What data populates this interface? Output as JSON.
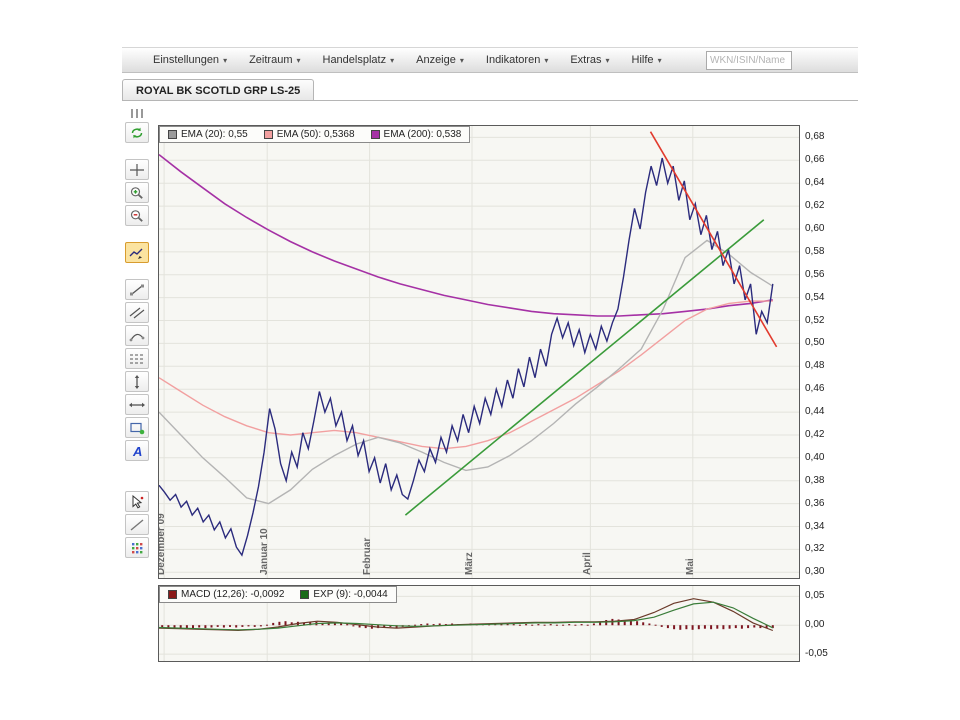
{
  "menubar": {
    "items": [
      {
        "label": "Einstellungen"
      },
      {
        "label": "Zeitraum"
      },
      {
        "label": "Handelsplatz"
      },
      {
        "label": "Anzeige"
      },
      {
        "label": "Indikatoren"
      },
      {
        "label": "Extras"
      },
      {
        "label": "Hilfe"
      }
    ],
    "search_placeholder": "WKN/ISIN/Name"
  },
  "tab": {
    "label": "ROYAL BK SCOTLD GRP LS-25"
  },
  "toolbar": {
    "items": [
      "drag-grip",
      "refresh",
      "crosshair",
      "zoom-in",
      "zoom-out",
      "chart-pointer-tool",
      "trend-line-tool",
      "parallel-channel-tool",
      "arc-tool",
      "horizontal-levels-tool",
      "vertical-line-tool",
      "horizontal-line-tool",
      "rectangle-tool",
      "text-tool",
      "cursor-tool",
      "line-tool",
      "more-tools"
    ],
    "selected": "chart-pointer-tool"
  },
  "main_legend": [
    {
      "label": "EMA (20): 0,55",
      "color": "#9a9a9a"
    },
    {
      "label": "EMA (50): 0,5368",
      "color": "#f2a0a0"
    },
    {
      "label": "EMA (200): 0,538",
      "color": "#a531a5"
    }
  ],
  "macd_legend": [
    {
      "label": "MACD (12,26): -0,0092",
      "color": "#8b1a1a"
    },
    {
      "label": "EXP (9): -0,0044",
      "color": "#1a6b1a"
    }
  ],
  "chart_data": {
    "type": "line",
    "title": "ROYAL BK SCOTLD GRP LS-25",
    "colors": {
      "grid": "#e3e3dc"
    },
    "months": [
      {
        "t": 0.008,
        "label": "Dezember 09"
      },
      {
        "t": 0.169,
        "label": "Januar 10"
      },
      {
        "t": 0.329,
        "label": "Februar"
      },
      {
        "t": 0.489,
        "label": "März"
      },
      {
        "t": 0.674,
        "label": "April"
      },
      {
        "t": 0.834,
        "label": "Mai"
      }
    ],
    "main": {
      "vmin": 0.295,
      "vmax": 0.69,
      "y_ticks": [
        0.68,
        0.66,
        0.64,
        0.62,
        0.6,
        0.58,
        0.56,
        0.54,
        0.52,
        0.5,
        0.48,
        0.46,
        0.44,
        0.42,
        0.4,
        0.38,
        0.36,
        0.34,
        0.32,
        0.3
      ],
      "series": [
        {
          "name": "EMA (200)",
          "color": "#a531a5",
          "width": 1.6,
          "t0": 0,
          "t1": 0.959,
          "values": [
            0.665,
            0.65,
            0.636,
            0.622,
            0.61,
            0.599,
            0.589,
            0.58,
            0.572,
            0.565,
            0.558,
            0.552,
            0.547,
            0.542,
            0.538,
            0.534,
            0.531,
            0.528,
            0.526,
            0.525,
            0.524,
            0.524,
            0.525,
            0.526,
            0.528,
            0.53,
            0.533,
            0.535,
            0.538
          ]
        },
        {
          "name": "EMA (50)",
          "color": "#f2a0a0",
          "width": 1.4,
          "t0": 0,
          "t1": 0.959,
          "values": [
            0.47,
            0.458,
            0.446,
            0.436,
            0.428,
            0.422,
            0.42,
            0.422,
            0.424,
            0.422,
            0.418,
            0.414,
            0.41,
            0.408,
            0.41,
            0.415,
            0.422,
            0.432,
            0.442,
            0.452,
            0.464,
            0.476,
            0.49,
            0.505,
            0.52,
            0.53,
            0.535,
            0.537,
            0.537
          ]
        },
        {
          "name": "EMA (20)",
          "color": "#b4b4b4",
          "width": 1.4,
          "t0": 0,
          "t1": 0.959,
          "values": [
            0.44,
            0.42,
            0.4,
            0.383,
            0.365,
            0.36,
            0.372,
            0.39,
            0.402,
            0.412,
            0.418,
            0.413,
            0.405,
            0.396,
            0.389,
            0.392,
            0.402,
            0.415,
            0.43,
            0.447,
            0.462,
            0.478,
            0.495,
            0.53,
            0.575,
            0.59,
            0.578,
            0.562,
            0.55
          ]
        },
        {
          "name": "price",
          "color": "#2b2b7d",
          "width": 1.4,
          "t0": 0,
          "t1": 0.959,
          "values": [
            0.376,
            0.37,
            0.363,
            0.368,
            0.357,
            0.362,
            0.35,
            0.356,
            0.344,
            0.35,
            0.337,
            0.344,
            0.33,
            0.338,
            0.322,
            0.315,
            0.332,
            0.352,
            0.375,
            0.405,
            0.443,
            0.425,
            0.395,
            0.38,
            0.405,
            0.392,
            0.422,
            0.408,
            0.432,
            0.458,
            0.44,
            0.452,
            0.428,
            0.44,
            0.415,
            0.428,
            0.402,
            0.415,
            0.388,
            0.4,
            0.378,
            0.395,
            0.372,
            0.385,
            0.368,
            0.364,
            0.38,
            0.398,
            0.388,
            0.408,
            0.396,
            0.418,
            0.405,
            0.428,
            0.415,
            0.438,
            0.422,
            0.445,
            0.43,
            0.452,
            0.438,
            0.46,
            0.445,
            0.468,
            0.452,
            0.478,
            0.462,
            0.488,
            0.47,
            0.495,
            0.48,
            0.508,
            0.522,
            0.505,
            0.518,
            0.498,
            0.512,
            0.492,
            0.508,
            0.495,
            0.515,
            0.502,
            0.518,
            0.53,
            0.558,
            0.59,
            0.618,
            0.6,
            0.632,
            0.655,
            0.638,
            0.662,
            0.64,
            0.655,
            0.625,
            0.642,
            0.608,
            0.622,
            0.595,
            0.612,
            0.582,
            0.598,
            0.568,
            0.582,
            0.552,
            0.568,
            0.538,
            0.552,
            0.508,
            0.528,
            0.518,
            0.552
          ]
        }
      ],
      "trendlines": [
        {
          "color": "#3a9b3a",
          "t0": 0.385,
          "v0": 0.35,
          "t1": 0.945,
          "v1": 0.608
        },
        {
          "color": "#e23b2e",
          "t0": 0.768,
          "v0": 0.685,
          "t1": 0.965,
          "v1": 0.497
        }
      ]
    },
    "macd": {
      "vmin": -0.062,
      "vmax": 0.068,
      "y_ticks": [
        0.05,
        0.0,
        -0.05
      ],
      "histogram": {
        "color": "#7d1520",
        "t0": 0.005,
        "t1": 0.959,
        "values": [
          -0.004,
          -0.005,
          -0.004,
          -0.005,
          -0.006,
          -0.005,
          -0.004,
          -0.005,
          -0.004,
          -0.003,
          -0.004,
          -0.003,
          -0.004,
          -0.003,
          -0.002,
          -0.003,
          -0.002,
          0.001,
          0.004,
          0.006,
          0.007,
          0.005,
          0.006,
          0.004,
          0.005,
          0.006,
          0.004,
          0.005,
          0.003,
          0.004,
          0.002,
          -0.002,
          -0.004,
          -0.005,
          -0.006,
          -0.005,
          -0.004,
          -0.003,
          -0.004,
          -0.003,
          -0.002,
          0.001,
          0.002,
          0.003,
          0.002,
          0.003,
          0.002,
          0.003,
          0.002,
          0.002,
          0.003,
          0.002,
          0.003,
          0.002,
          0.003,
          0.002,
          0.003,
          0.002,
          0.001,
          0.002,
          0.001,
          0.002,
          0.001,
          0.002,
          0.001,
          0.001,
          0.002,
          0.001,
          0.002,
          0.001,
          0.003,
          0.006,
          0.009,
          0.011,
          0.01,
          0.008,
          0.009,
          0.007,
          0.005,
          0.003,
          0.001,
          -0.003,
          -0.005,
          -0.007,
          -0.008,
          -0.007,
          -0.008,
          -0.007,
          -0.006,
          -0.007,
          -0.006,
          -0.007,
          -0.006,
          -0.005,
          -0.006,
          -0.005,
          -0.004,
          -0.005,
          -0.005,
          -0.005
        ]
      },
      "series": [
        {
          "name": "MACD",
          "color": "#6b3a2a",
          "width": 1.2,
          "t0": 0,
          "t1": 0.959,
          "values": [
            -0.005,
            -0.006,
            -0.007,
            -0.008,
            -0.009,
            -0.007,
            -0.003,
            0.003,
            0.007,
            0.005,
            0.001,
            -0.003,
            -0.005,
            -0.003,
            -0.001,
            0.001,
            0.002,
            0.003,
            0.004,
            0.005,
            0.005,
            0.006,
            0.006,
            0.007,
            0.01,
            0.022,
            0.038,
            0.046,
            0.04,
            0.024,
            0.004,
            -0.0092
          ]
        },
        {
          "name": "EXP",
          "color": "#3a7d3a",
          "width": 1.2,
          "t0": 0,
          "t1": 0.959,
          "values": [
            -0.004,
            -0.005,
            -0.006,
            -0.007,
            -0.008,
            -0.007,
            -0.005,
            -0.001,
            0.003,
            0.004,
            0.003,
            0.001,
            -0.001,
            -0.002,
            -0.001,
            0.0,
            0.001,
            0.002,
            0.003,
            0.004,
            0.004,
            0.005,
            0.005,
            0.006,
            0.008,
            0.014,
            0.026,
            0.037,
            0.04,
            0.03,
            0.012,
            -0.0044
          ]
        }
      ]
    }
  }
}
